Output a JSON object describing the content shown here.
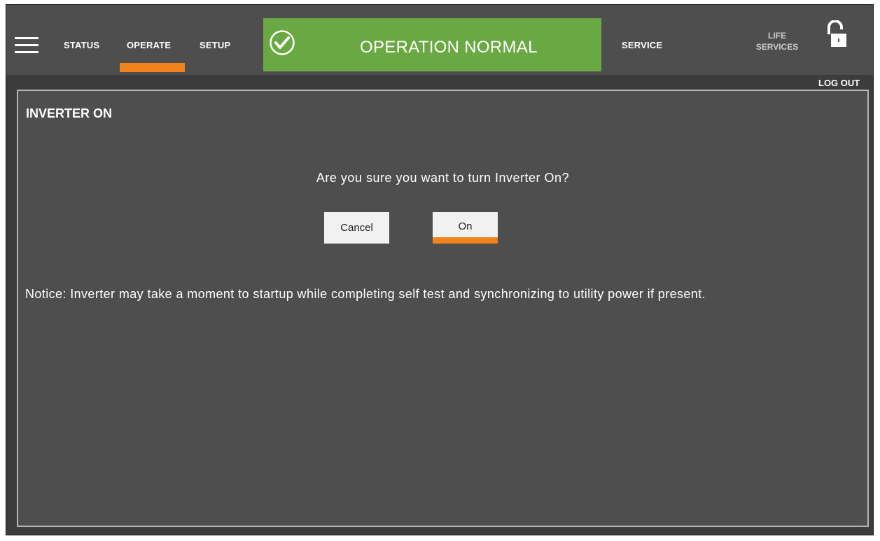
{
  "nav": {
    "items": [
      "STATUS",
      "OPERATE",
      "SETUP"
    ],
    "active": "OPERATE",
    "service_label": "SERVICE",
    "life_services_label_line1": "LIFE",
    "life_services_label_line2": "SERVICES",
    "logout_label": "LOG OUT",
    "icons": [
      "hamburger-menu-icon",
      "check-circle-icon",
      "unlocked-padlock-icon"
    ]
  },
  "status": {
    "text": "OPERATION NORMAL",
    "color": "#6aa844"
  },
  "dialog": {
    "title": "INVERTER ON",
    "question": "Are you sure you want to turn Inverter On?",
    "cancel_label": "Cancel",
    "confirm_label": "On",
    "notice": "Notice: Inverter may take a moment to startup while completing self test and synchronizing to utility power if present."
  },
  "colors": {
    "accent": "#f0841c",
    "bar": "#4d4e4d",
    "panel": "#4d4e4d"
  }
}
